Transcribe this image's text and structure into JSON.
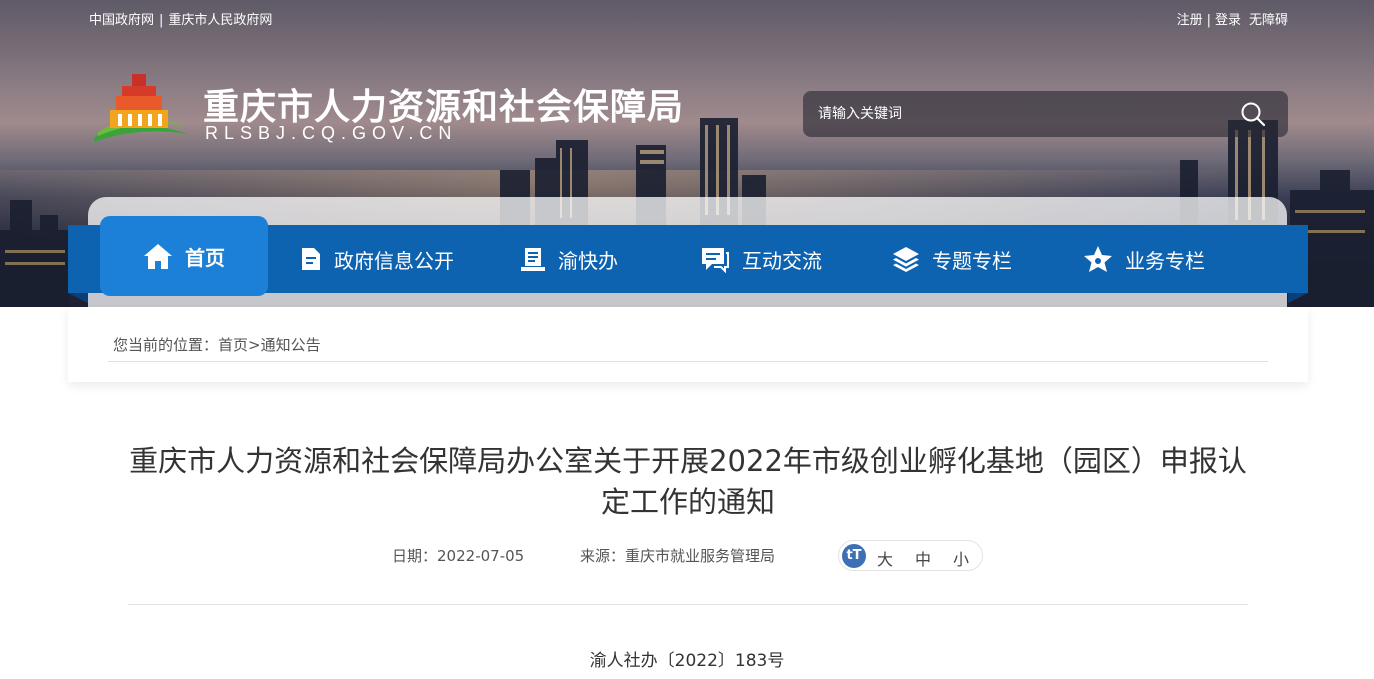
{
  "top_links": {
    "gov_cn": "中国政府网",
    "separator": "|",
    "cq_gov": "重庆市人民政府网",
    "register": "注册",
    "login": "登录",
    "accessibility": "无障碍"
  },
  "site": {
    "title": "重庆市人力资源和社会保障局",
    "domain": "RLSBJ.CQ.GOV.CN"
  },
  "search": {
    "placeholder": "请输入关键词"
  },
  "nav": [
    {
      "label": "首页",
      "icon": "home-icon",
      "active": true
    },
    {
      "label": "政府信息公开",
      "icon": "document-icon",
      "active": false
    },
    {
      "label": "渝快办",
      "icon": "book-icon",
      "active": false
    },
    {
      "label": "互动交流",
      "icon": "chat-icon",
      "active": false
    },
    {
      "label": "专题专栏",
      "icon": "layers-icon",
      "active": false
    },
    {
      "label": "业务专栏",
      "icon": "star-icon",
      "active": false
    }
  ],
  "breadcrumb": {
    "prefix": "您当前的位置：",
    "home": "首页",
    "arrow": ">",
    "current": "通知公告"
  },
  "article": {
    "title": "重庆市人力资源和社会保障局办公室关于开展2022年市级创业孵化基地（园区）申报认定工作的通知",
    "date_label": "日期：",
    "date": "2022-07-05",
    "source_label": "来源：",
    "source": "重庆市就业服务管理局",
    "font_large": "大",
    "font_medium": "中",
    "font_small": "小",
    "doc_number": "渝人社办〔2022〕183号"
  },
  "colors": {
    "nav_bg": "#0e63b1",
    "nav_active": "#1c80d8"
  }
}
